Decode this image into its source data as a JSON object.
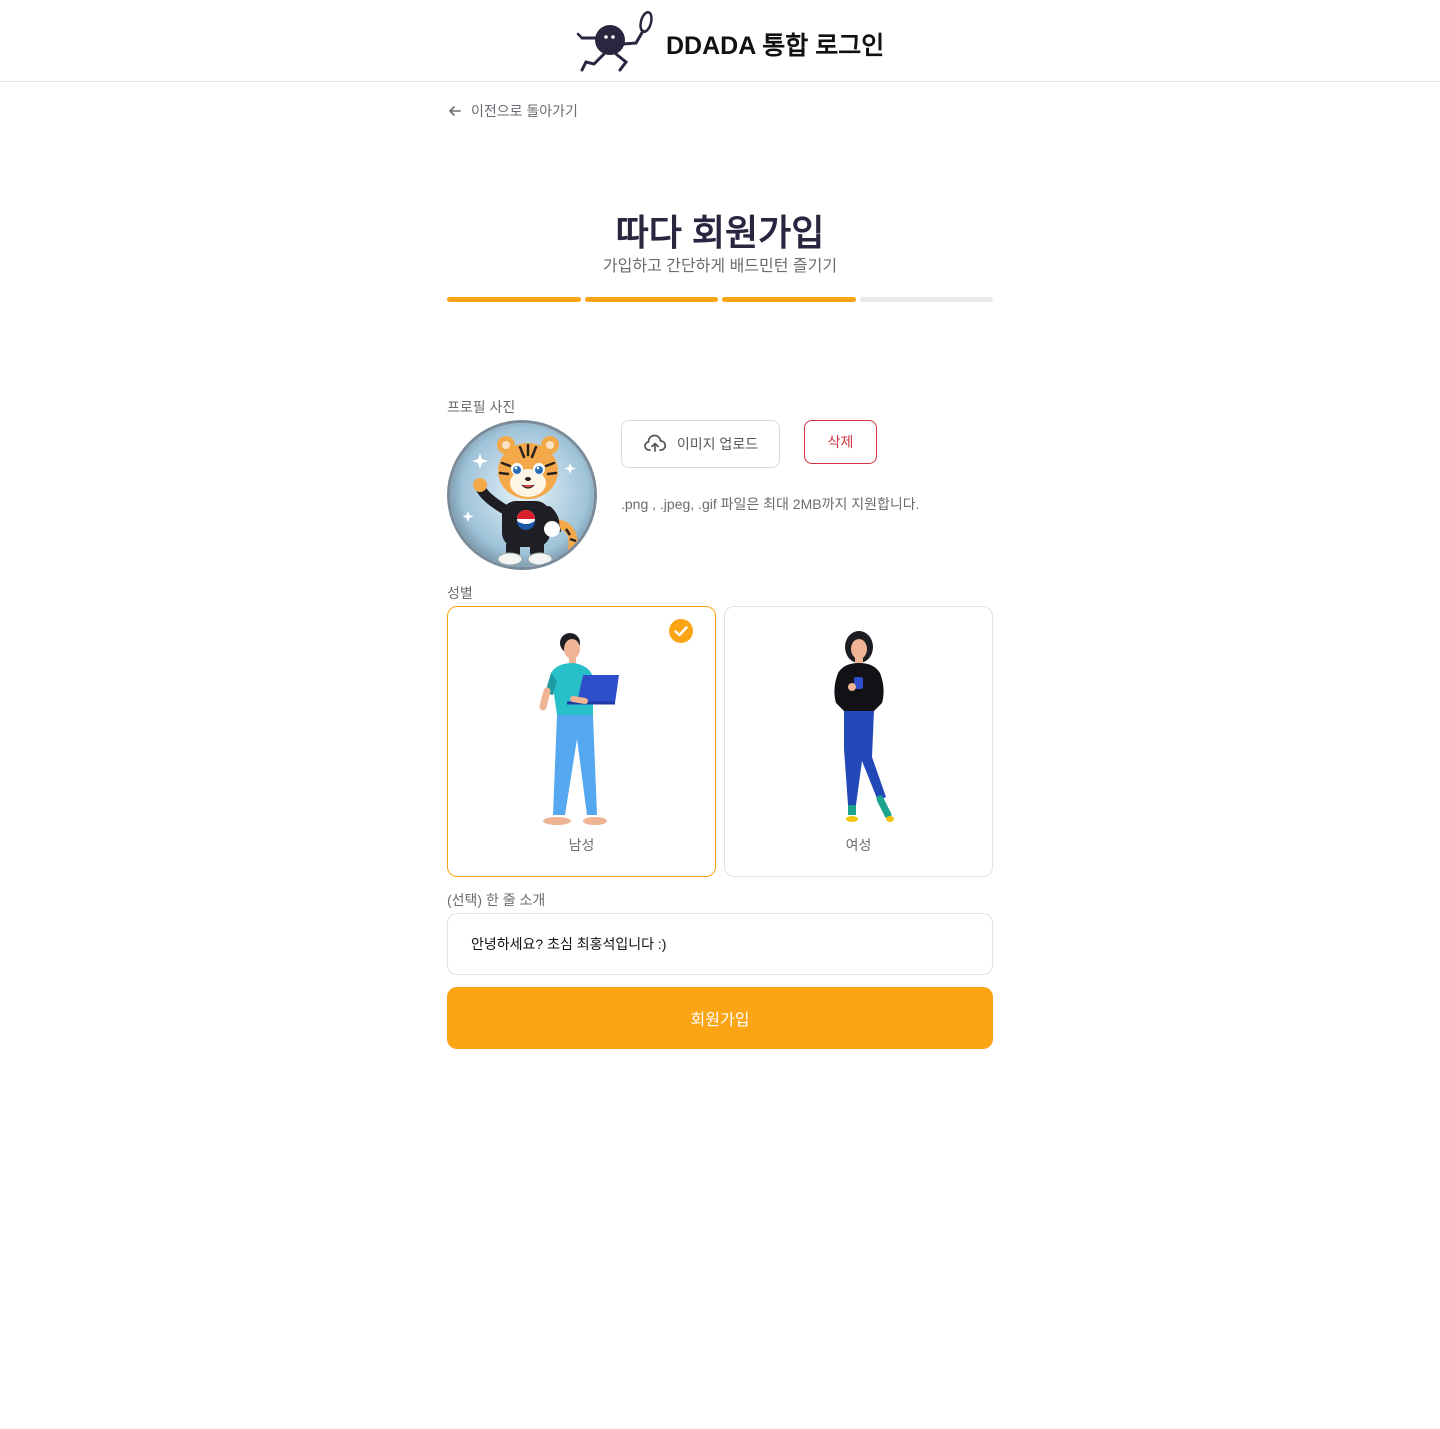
{
  "header": {
    "title": "DDADA 통합 로그인",
    "logo_icon": "badminton-mascot-logo"
  },
  "nav": {
    "back_label": "이전으로 돌아가기"
  },
  "page": {
    "title": "따다 회원가입",
    "subtitle": "가입하고 간단하게 배드민턴 즐기기"
  },
  "progress": {
    "steps_total": 4,
    "steps_done": 3,
    "active_color": "#fba414",
    "inactive_color": "#e9e9ec"
  },
  "profile": {
    "label": "프로필 사진",
    "upload_label": "이미지 업로드",
    "delete_label": "삭제",
    "hint": ".png , .jpeg, .gif 파일은 최대 2MB까지 지원합니다."
  },
  "gender": {
    "label": "성별",
    "options": [
      {
        "label": "남성",
        "selected": true
      },
      {
        "label": "여성",
        "selected": false
      }
    ]
  },
  "intro": {
    "label": "(선택) 한 줄 소개",
    "value": "안녕하세요? 초심 최홍석입니다 :)"
  },
  "submit": {
    "label": "회원가입"
  },
  "colors": {
    "accent": "#fba414",
    "danger": "#d1343e",
    "title": "#2a2640"
  }
}
